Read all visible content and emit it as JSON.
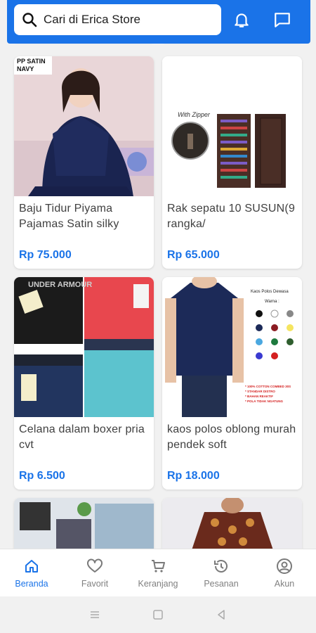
{
  "search": {
    "placeholder": "Cari di Erica Store"
  },
  "header": {
    "icons": [
      "bell-icon",
      "chat-icon"
    ]
  },
  "products": [
    {
      "badge": "PP SATIN NAVY",
      "title": "Baju Tidur Piyama Pajamas Satin silky",
      "price": "Rp 75.000"
    },
    {
      "badge_overlay": "With Zipper",
      "title": "Rak sepatu 10 SUSUN(9 rangka/",
      "price": "Rp 65.000"
    },
    {
      "brand_text": "UNDER ARMOUR",
      "title": "Celana dalam boxer pria cvt",
      "price": "Rp 6.500"
    },
    {
      "overlay_title": "Kaos Polos Dewasa",
      "overlay_sub": "Warna :",
      "overlay_lines": [
        "* 100% COTTON COMBED 30S",
        "* STANDAR DISTRO",
        "* BAHAN REAKTIF",
        "* POLA TIDAK NGATUNG"
      ],
      "title": "kaos polos oblong murah pendek soft",
      "price": "Rp 18.000"
    }
  ],
  "nav": [
    {
      "label": "Beranda",
      "icon": "home-icon",
      "active": true
    },
    {
      "label": "Favorit",
      "icon": "heart-icon"
    },
    {
      "label": "Keranjang",
      "icon": "cart-icon"
    },
    {
      "label": "Pesanan",
      "icon": "history-icon"
    },
    {
      "label": "Akun",
      "icon": "account-icon"
    }
  ],
  "colors": {
    "accent": "#1a73e8",
    "price": "#1a73e8"
  }
}
